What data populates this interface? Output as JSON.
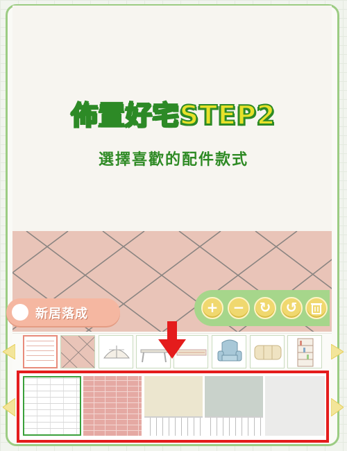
{
  "header": {
    "title": "佈置好宅STEP2",
    "subtitle": "選擇喜歡的配件款式"
  },
  "badge": {
    "label": "新居落成"
  },
  "tools": [
    {
      "name": "zoom-in",
      "glyph": "+"
    },
    {
      "name": "zoom-out",
      "glyph": "−"
    },
    {
      "name": "rotate-right",
      "glyph": "↻"
    },
    {
      "name": "rotate-left",
      "glyph": "↺"
    },
    {
      "name": "delete",
      "glyph": "🗑"
    }
  ],
  "category_thumbnails": [
    "wall-thumb",
    "floor-thumb",
    "arch-window-thumb",
    "table-thumb",
    "rug-thumb",
    "armchair-thumb",
    "sofa-thumb",
    "bookshelf-thumb"
  ],
  "swatches": [
    {
      "name": "white-brick"
    },
    {
      "name": "red-brick"
    },
    {
      "name": "cream-wainscot"
    },
    {
      "name": "sage-wainscot"
    },
    {
      "name": "light-gray-plaster"
    }
  ],
  "colors": {
    "frame_green": "#9ccc83",
    "title_yellow": "#e7e12a",
    "title_outline": "#2d8a26",
    "floor_pink": "#e9c4b8",
    "highlight_red": "#e41c1c",
    "badge_salmon": "#f5b7a1",
    "tool_yellow": "#f0d86f"
  }
}
